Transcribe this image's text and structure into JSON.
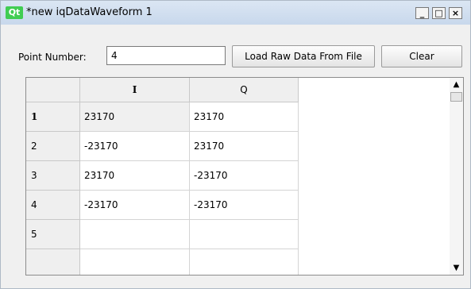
{
  "window": {
    "title": "*new iqDataWaveform 1",
    "logo_text": "Qt",
    "controls": {
      "minimize": "_",
      "maximize": "□",
      "close": "×"
    }
  },
  "toolbar": {
    "point_number_label": "Point Number:",
    "point_number_value": "4",
    "load_button": "Load Raw Data From File",
    "clear_button": "Clear"
  },
  "table": {
    "columns": [
      "I",
      "Q"
    ],
    "rows": [
      {
        "header": "1",
        "i": "23170",
        "q": "23170"
      },
      {
        "header": "2",
        "i": "-23170",
        "q": "23170"
      },
      {
        "header": "3",
        "i": "23170",
        "q": "-23170"
      },
      {
        "header": "4",
        "i": "-23170",
        "q": "-23170"
      },
      {
        "header": "5",
        "i": "",
        "q": ""
      }
    ]
  },
  "scrollbar": {
    "up_icon": "arrow-up-icon",
    "down_icon": "arrow-down-icon"
  }
}
